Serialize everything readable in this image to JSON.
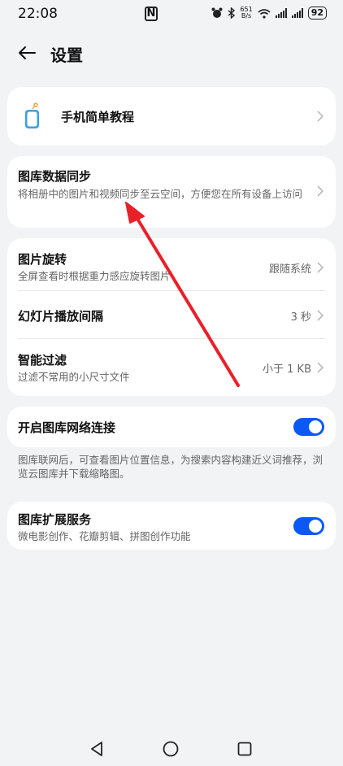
{
  "status": {
    "time": "22:08",
    "nfc": "N",
    "speed_value": "651",
    "speed_unit": "B/s",
    "battery": "92"
  },
  "header": {
    "title": "设置"
  },
  "tutorial": {
    "label": "手机简单教程"
  },
  "sync": {
    "title": "图库数据同步",
    "desc": "将相册中的图片和视频同步至云空间，方便您在所有设备上访问"
  },
  "display": {
    "rotate_title": "图片旋转",
    "rotate_desc": "全屏查看时根据重力感应旋转图片",
    "rotate_value": "跟随系统",
    "slideshow_title": "幻灯片播放间隔",
    "slideshow_value": "3 秒",
    "filter_title": "智能过滤",
    "filter_desc": "过滤不常用的小尺寸文件",
    "filter_value": "小于 1 KB"
  },
  "network": {
    "title": "开启图库网络连接",
    "enabled": true,
    "note": "图库联网后，可查看图片位置信息，为搜索内容构建近义词推荐，浏览云图库并下载缩略图。"
  },
  "extension": {
    "title": "图库扩展服务",
    "desc": "微电影创作、花瓣剪辑、拼图创作功能",
    "enabled": true
  },
  "colors": {
    "accent": "#0a59f7",
    "annotation": "#e8202a"
  },
  "icons": {
    "back": "back-arrow-icon",
    "tutorial": "phone-tutorial-icon",
    "chevron": "chevron-right-icon",
    "nav_back": "nav-back-icon",
    "nav_home": "nav-home-icon",
    "nav_recents": "nav-recents-icon"
  }
}
